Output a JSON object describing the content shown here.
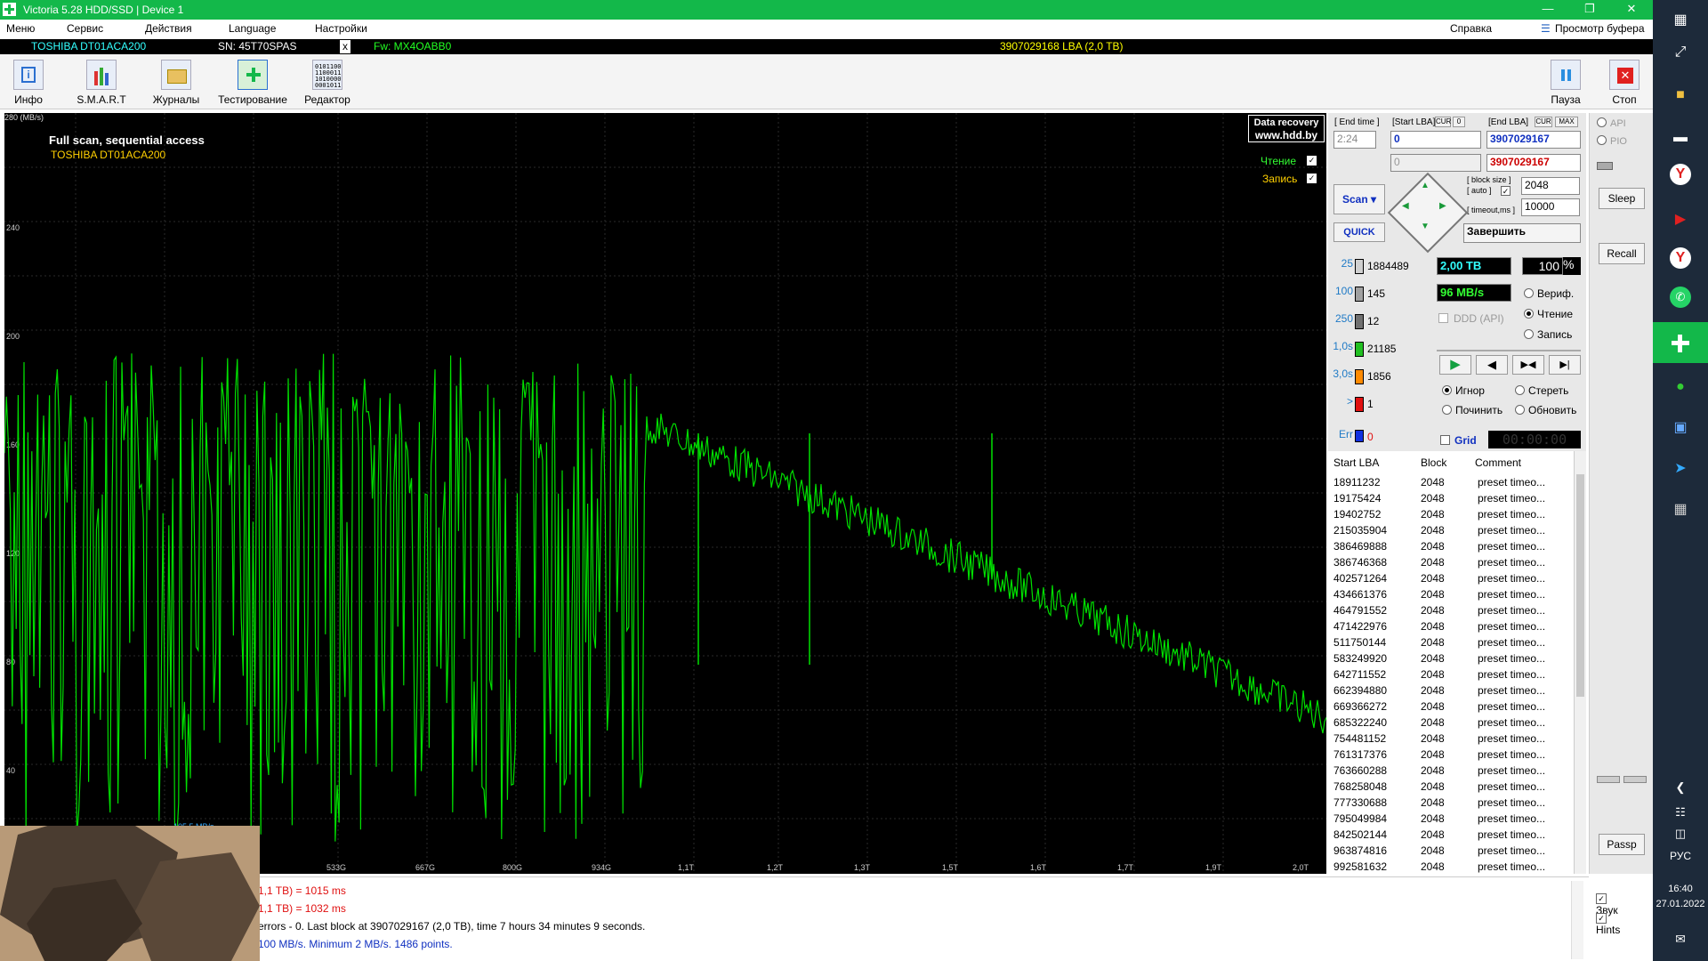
{
  "window": {
    "title": "Victoria 5.28 HDD/SSD | Device 1"
  },
  "menu": {
    "items": [
      "Меню",
      "Сервис",
      "Действия",
      "Language",
      "Настройки"
    ],
    "help": "Справка",
    "buffer": "Просмотр буфера"
  },
  "device": {
    "model": "TOSHIBA DT01ACA200",
    "sn": "SN: 45T70SPAS",
    "x": "x",
    "fw": "Fw: MX4OABB0",
    "lba": "3907029168 LBA (2,0 TB)"
  },
  "toolbar": {
    "info": "Инфо",
    "smart": "S.M.A.R.T",
    "logs": "Журналы",
    "test": "Тестирование",
    "editor": "Редактор",
    "pause": "Пауза",
    "stop": "Стоп"
  },
  "graph": {
    "title": "Full scan, sequential access",
    "drive": "TOSHIBA DT01ACA200",
    "read_label": "Чтение",
    "write_label": "Запись",
    "watermark_1": "Data recovery",
    "watermark_2": "www.hdd.by",
    "unit": "280 (MB/s)",
    "y_ticks": [
      "240",
      "200",
      "160",
      "120",
      "80",
      "40"
    ],
    "x_ticks": [
      "533G",
      "667G",
      "800G",
      "934G",
      "1,1T",
      "1,2T",
      "1,3T",
      "1,5T",
      "1,6T",
      "1,7T",
      "1,9T",
      "2,0T"
    ],
    "mark_label": "105,5 MB/s",
    "read_color": "#00e000"
  },
  "controls": {
    "end_time_lbl": "[ End time ]",
    "start_lba_lbl": "[Start LBA]",
    "cur": "CUR",
    "zero": "0",
    "end_lba_lbl": "[End LBA]",
    "max": "MAX",
    "end_time": "2:24",
    "start_lba": "0",
    "end_lba": "3907029167",
    "start_lba2": "0",
    "end_lba2": "3907029167",
    "block_size_lbl": "[ block size ]",
    "auto_lbl": "[ auto ]",
    "block_size": "2048",
    "timeout_lbl": "[ timeout,ms ]",
    "timeout": "10000",
    "scan": "Scan",
    "quick": "QUICK",
    "finish": "Завершить",
    "api": "API",
    "pio": "PIO",
    "sleep": "Sleep",
    "recall": "Recall",
    "passp": "Passp",
    "sound": "Звук",
    "hints": "Hints"
  },
  "legend": [
    {
      "key": "25",
      "value": "1884489",
      "color": "#d0d0d0"
    },
    {
      "key": "100",
      "value": "145",
      "color": "#a0a0a0"
    },
    {
      "key": "250",
      "value": "12",
      "color": "#707070"
    },
    {
      "key": "1,0s",
      "value": "21185",
      "color": "#22c022"
    },
    {
      "key": "3,0s",
      "value": "1856",
      "color": "#ff8a00"
    },
    {
      "key": ">",
      "value": "1",
      "color": "#e01010"
    },
    {
      "key": "Err",
      "value": "0",
      "color": "#1030e0"
    }
  ],
  "stats": {
    "size": "2,00 TB",
    "percent": "100",
    "pct_sign": "%",
    "speed": "96 MB/s",
    "ddd": "DDD (API)",
    "timer": "00:00:00",
    "grid": "Grid"
  },
  "modes": {
    "verify": "Вериф.",
    "read": "Чтение",
    "write": "Запись",
    "ignore": "Игнор",
    "erase": "Стереть",
    "fix": "Починить",
    "refresh": "Обновить"
  },
  "table": {
    "headers": [
      "Start LBA",
      "Block",
      "Comment"
    ],
    "rows": [
      [
        "18911232",
        "2048",
        "preset timeo..."
      ],
      [
        "19175424",
        "2048",
        "preset timeo..."
      ],
      [
        "19402752",
        "2048",
        "preset timeo..."
      ],
      [
        "215035904",
        "2048",
        "preset timeo..."
      ],
      [
        "386469888",
        "2048",
        "preset timeo..."
      ],
      [
        "386746368",
        "2048",
        "preset timeo..."
      ],
      [
        "402571264",
        "2048",
        "preset timeo..."
      ],
      [
        "434661376",
        "2048",
        "preset timeo..."
      ],
      [
        "464791552",
        "2048",
        "preset timeo..."
      ],
      [
        "471422976",
        "2048",
        "preset timeo..."
      ],
      [
        "511750144",
        "2048",
        "preset timeo..."
      ],
      [
        "583249920",
        "2048",
        "preset timeo..."
      ],
      [
        "642711552",
        "2048",
        "preset timeo..."
      ],
      [
        "662394880",
        "2048",
        "preset timeo..."
      ],
      [
        "669366272",
        "2048",
        "preset timeo..."
      ],
      [
        "685322240",
        "2048",
        "preset timeo..."
      ],
      [
        "754481152",
        "2048",
        "preset timeo..."
      ],
      [
        "761317376",
        "2048",
        "preset timeo..."
      ],
      [
        "763660288",
        "2048",
        "preset timeo..."
      ],
      [
        "768258048",
        "2048",
        "preset timeo..."
      ],
      [
        "777330688",
        "2048",
        "preset timeo..."
      ],
      [
        "795049984",
        "2048",
        "preset timeo..."
      ],
      [
        "842502144",
        "2048",
        "preset timeo..."
      ],
      [
        "963874816",
        "2048",
        "preset timeo..."
      ],
      [
        "992581632",
        "2048",
        "preset timeo..."
      ]
    ]
  },
  "log": [
    {
      "text": "1,1 TB)  = 1015 ms",
      "color": "#e01010"
    },
    {
      "text": "1,1 TB)  = 1032 ms",
      "color": "#e01010"
    },
    {
      "text": "errors - 0. Last block at 3907029167 (2,0 TB), time 7 hours 34 minutes 9 seconds.",
      "color": "#000000"
    },
    {
      "text": "100 MB/s. Minimum 2 MB/s. 1486 points.",
      "color": "#1030c0"
    }
  ],
  "taskbar": {
    "lang": "РУС",
    "time": "16:40",
    "date": "27.01.2022"
  }
}
